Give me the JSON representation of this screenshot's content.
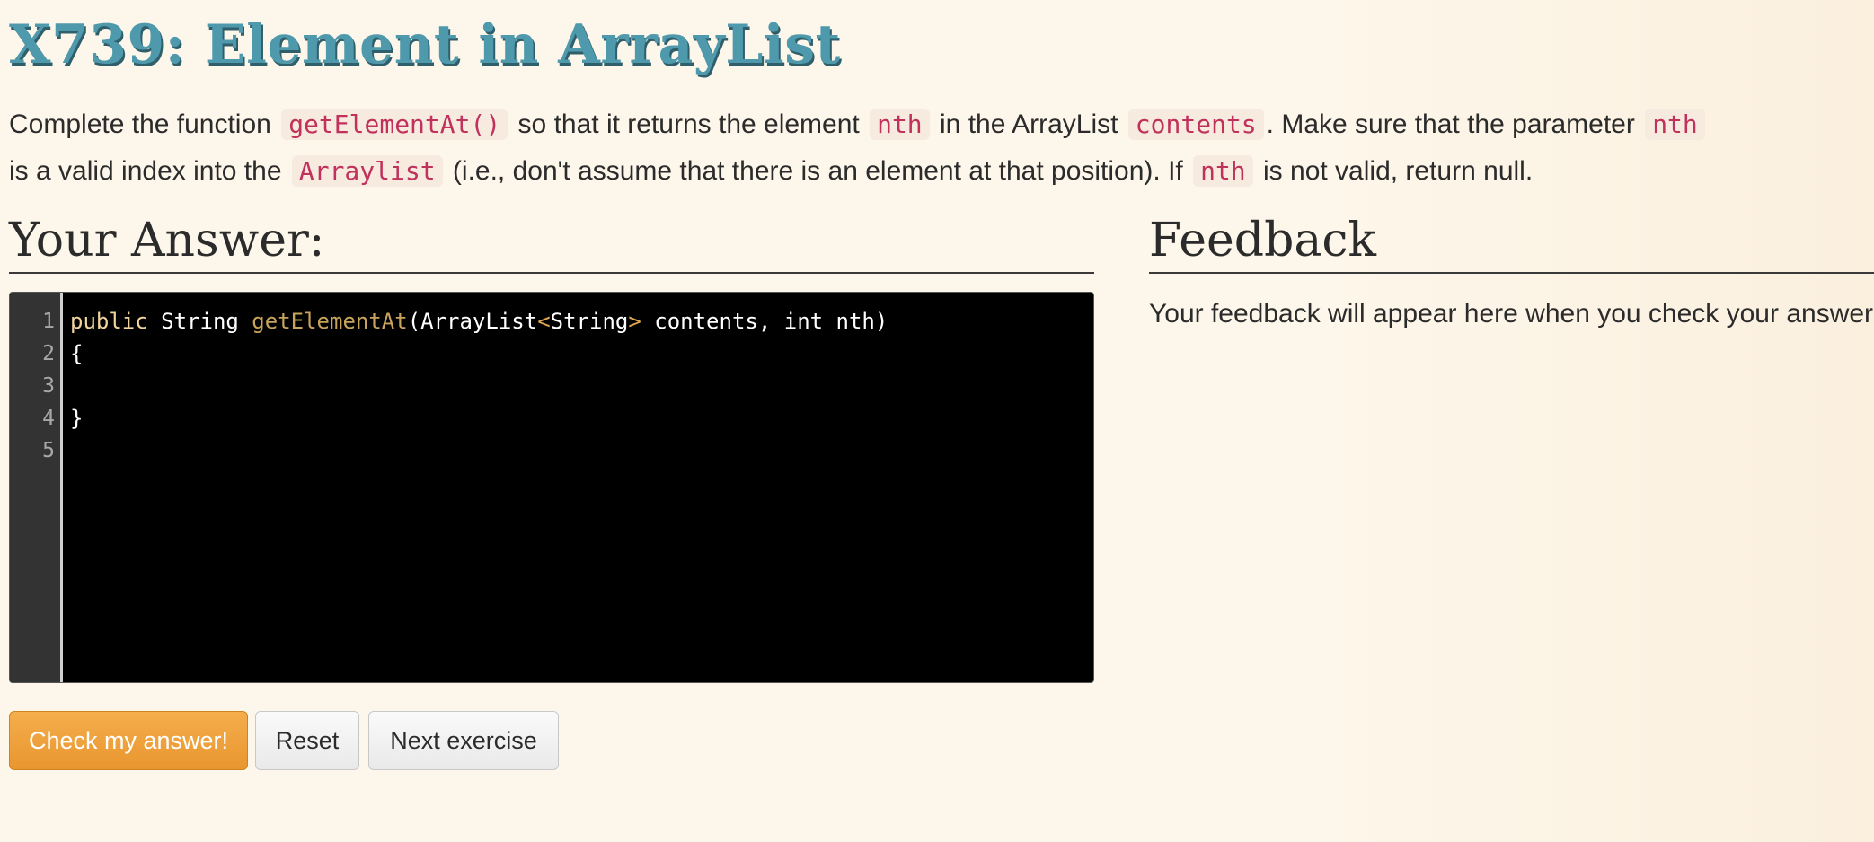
{
  "exercise": {
    "title": "X739: Element in ArrayList",
    "description": {
      "t1": "Complete the function",
      "c1": "getElementAt()",
      "t2": "so that it returns the element",
      "c2": "nth",
      "t3": "in the ArrayList",
      "c3": "contents",
      "t4": ". Make sure that the parameter",
      "c4": "nth",
      "t5": "is a valid index into the",
      "c5": "Arraylist",
      "t6": "(i.e., don't assume that there is an element at that position). If",
      "c6": "nth",
      "t7": "is not valid, return null."
    }
  },
  "answer": {
    "heading": "Your Answer:",
    "line_numbers": [
      "1",
      "2",
      "3",
      "4",
      "5"
    ],
    "code": {
      "l1_kw": "public",
      "l1_type": " String ",
      "l1_fn": "getElementAt",
      "l1_a": "(ArrayList",
      "l1_lt": "<",
      "l1_gen": "String",
      "l1_gt": ">",
      "l1_b": " contents, int nth)",
      "l2": "{",
      "l3": "",
      "l4": "}",
      "l5": ""
    }
  },
  "buttons": {
    "check": "Check my answer!",
    "reset": "Reset",
    "next": "Next exercise"
  },
  "feedback": {
    "heading": "Feedback",
    "placeholder": "Your feedback will appear here when you check your answer."
  },
  "colors": {
    "title": "#4f99ad",
    "inline_code": "#c0315b",
    "primary_button": "#f0a43f",
    "editor_background": "#000000"
  }
}
